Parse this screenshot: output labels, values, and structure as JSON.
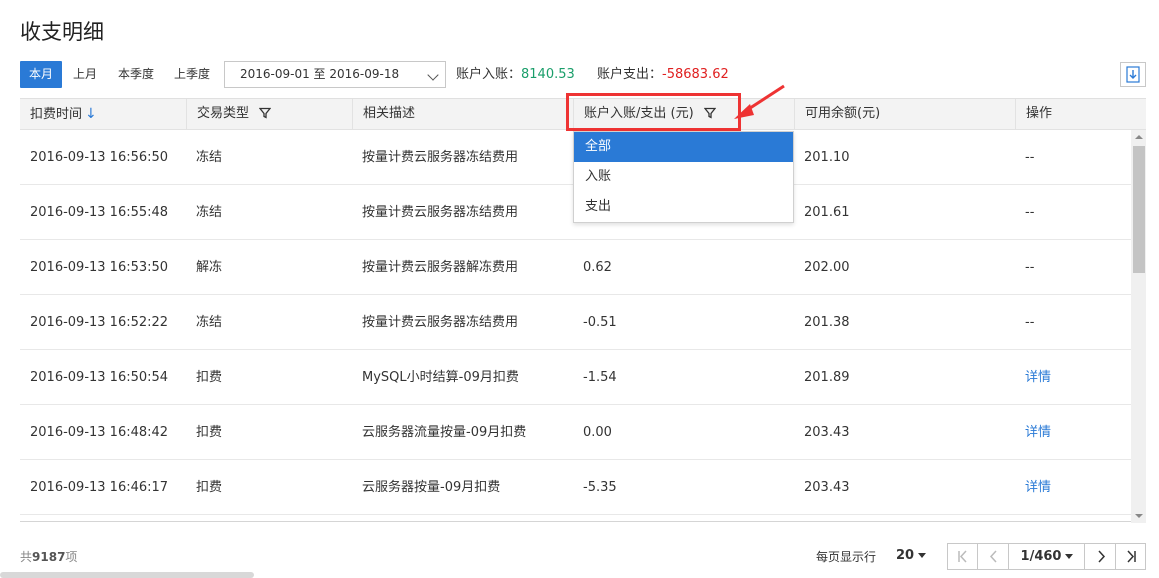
{
  "page": {
    "title": "收支明细"
  },
  "toolbar": {
    "tabs": [
      {
        "label": "本月",
        "active": true
      },
      {
        "label": "上月",
        "active": false
      },
      {
        "label": "本季度",
        "active": false
      },
      {
        "label": "上季度",
        "active": false
      }
    ],
    "date_range": "2016-09-01 至 2016-09-18",
    "income_label": "账户入账：",
    "income_value": "8140.53",
    "expense_label": "账户支出：",
    "expense_value": "-58683.62"
  },
  "table": {
    "headers": {
      "time": "扣费时间",
      "type": "交易类型",
      "desc": "相关描述",
      "amount": "账户入账/支出 (元)",
      "balance": "可用余额(元)",
      "action": "操作"
    },
    "rows": [
      {
        "time": "2016-09-13 16:56:50",
        "type": "冻结",
        "desc": "按量计费云服务器冻结费用",
        "amount": "",
        "amount_sign": "neg",
        "balance": "201.10",
        "action": "--"
      },
      {
        "time": "2016-09-13 16:55:48",
        "type": "冻结",
        "desc": "按量计费云服务器冻结费用",
        "amount": "",
        "amount_sign": "neg",
        "balance": "201.61",
        "action": "--"
      },
      {
        "time": "2016-09-13 16:53:50",
        "type": "解冻",
        "desc": "按量计费云服务器解冻费用",
        "amount": "0.62",
        "amount_sign": "pos",
        "balance": "202.00",
        "action": "--"
      },
      {
        "time": "2016-09-13 16:52:22",
        "type": "冻结",
        "desc": "按量计费云服务器冻结费用",
        "amount": "-0.51",
        "amount_sign": "neg",
        "balance": "201.38",
        "action": "--"
      },
      {
        "time": "2016-09-13 16:50:54",
        "type": "扣费",
        "desc": "MySQL小时结算-09月扣费",
        "amount": "-1.54",
        "amount_sign": "neg",
        "balance": "201.89",
        "action": "详情"
      },
      {
        "time": "2016-09-13 16:48:42",
        "type": "扣费",
        "desc": "云服务器流量按量-09月扣费",
        "amount": "0.00",
        "amount_sign": "neg",
        "balance": "203.43",
        "action": "详情"
      },
      {
        "time": "2016-09-13 16:46:17",
        "type": "扣费",
        "desc": "云服务器按量-09月扣费",
        "amount": "-5.35",
        "amount_sign": "neg",
        "balance": "203.43",
        "action": "详情"
      }
    ]
  },
  "filter_dropdown": {
    "options": [
      {
        "label": "全部",
        "selected": true
      },
      {
        "label": "入账",
        "selected": false
      },
      {
        "label": "支出",
        "selected": false
      }
    ]
  },
  "footer": {
    "total_prefix": "共",
    "total_count": "9187",
    "total_suffix": "项",
    "page_size_label": "每页显示行",
    "page_size": "20",
    "page_indicator": "1/460"
  },
  "colors": {
    "accent": "#2a7ad6",
    "positive": "#1a9e6a",
    "negative": "#e02020",
    "annotation": "#e33333"
  }
}
